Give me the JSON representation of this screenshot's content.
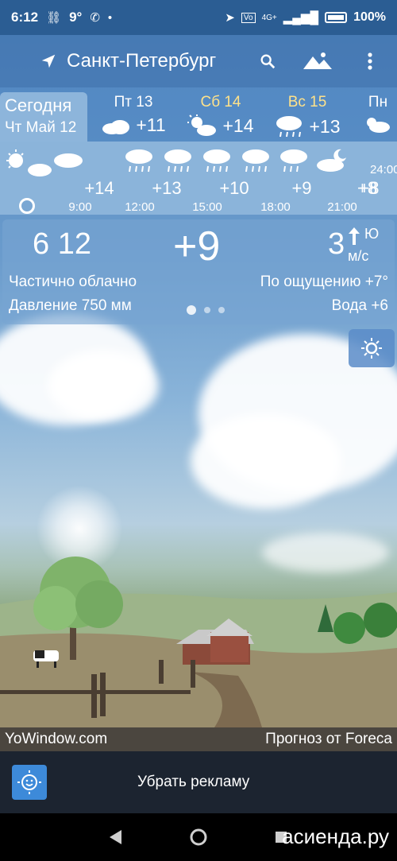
{
  "status_bar": {
    "time": "6:12",
    "temp": "9°",
    "battery": "100%",
    "network": "4G+"
  },
  "app_bar": {
    "city": "Санкт-Петербург",
    "icons": [
      "location-arrow-icon",
      "search-icon",
      "landscape-icon",
      "more-vert-icon"
    ]
  },
  "days": {
    "today_label": "Сегодня",
    "today_date": "Чт Май 12",
    "items": [
      {
        "name": "Пт 13",
        "temp": "+11",
        "icon": "cloudy-icon",
        "weekend": false
      },
      {
        "name": "Сб 14",
        "temp": "+14",
        "icon": "partly-cloudy-icon",
        "weekend": true
      },
      {
        "name": "Вс 15",
        "temp": "+13",
        "icon": "rain-icon",
        "weekend": true
      },
      {
        "name": "Пн",
        "temp": "",
        "icon": "cloudy-icon",
        "weekend": false
      }
    ]
  },
  "hourly": [
    {
      "temp": "+14",
      "hour": "9:00"
    },
    {
      "temp": "+13",
      "hour": "12:00"
    },
    {
      "temp": "+10",
      "hour": "15:00"
    },
    {
      "temp": "+9",
      "hour": "18:00"
    },
    {
      "temp": "+8",
      "hour": "21:00"
    },
    {
      "temp": "",
      "hour": "24:00"
    }
  ],
  "current": {
    "time": "6 12",
    "temp": "+9",
    "wind_speed": "3",
    "wind_dir": "Ю",
    "wind_unit": "м/с",
    "condition": "Частично облачно",
    "feels_like": "По ощущению +7°",
    "pressure": "Давление 750 мм",
    "water": "Вода +6"
  },
  "credits": {
    "left": "YoWindow.com",
    "right": "Прогноз от Foreca"
  },
  "ad": {
    "label": "Убрать рекламу"
  },
  "watermark": "асиенда.ру"
}
